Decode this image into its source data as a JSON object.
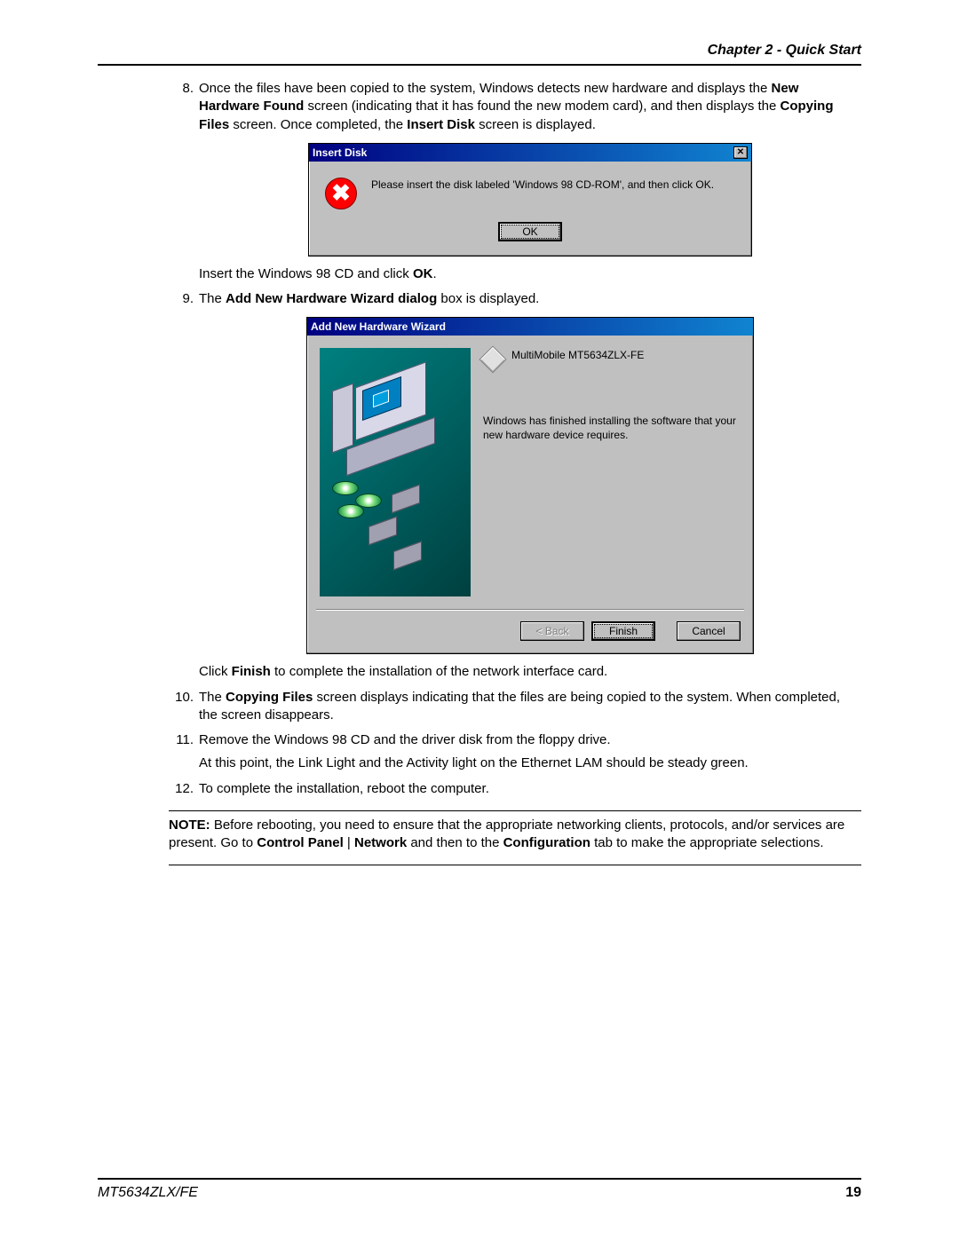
{
  "header": {
    "chapter": "Chapter 2 - Quick Start"
  },
  "step8": {
    "num": "8.",
    "text_a": "Once the files have been copied to the system, Windows detects new hardware and displays the ",
    "bold_a": "New Hardware Found",
    "text_b": " screen (indicating that it has found the new modem card), and then displays the ",
    "bold_b": "Copying Files",
    "text_c": " screen. Once completed, the ",
    "bold_c": "Insert Disk",
    "text_d": " screen is displayed.",
    "after_a": "Insert the Windows 98 CD and click ",
    "after_bold": "OK",
    "after_b": "."
  },
  "insert_dialog": {
    "title": "Insert Disk",
    "message": "Please insert the disk labeled 'Windows 98 CD-ROM', and then click OK.",
    "ok": "OK",
    "close_glyph": "✕"
  },
  "step9": {
    "num": "9.",
    "text_a": "The ",
    "bold_a": "Add New Hardware Wizard dialog",
    "text_b": " box is displayed.",
    "after_a": "Click ",
    "after_bold": "Finish",
    "after_b": " to complete the installation of the network interface card."
  },
  "wizard_dialog": {
    "title": "Add New Hardware Wizard",
    "device": "MultiMobile MT5634ZLX-FE",
    "message": "Windows has finished installing the software that your new hardware device requires.",
    "back": "< Back",
    "finish": "Finish",
    "cancel": "Cancel"
  },
  "step10": {
    "num": "10.",
    "text_a": "The ",
    "bold_a": "Copying Files",
    "text_b": " screen displays indicating that the files are being copied to the system. When completed, the screen disappears."
  },
  "step11": {
    "num": "11.",
    "line1": "Remove the Windows 98 CD and the driver disk from the floppy drive.",
    "line2": "At this point, the Link Light and the Activity light on the Ethernet LAM should be steady green."
  },
  "step12": {
    "num": "12.",
    "text": "To complete the installation, reboot the computer."
  },
  "note": {
    "label": "NOTE:",
    "a": " Before rebooting, you need to ensure that the appropriate networking clients, protocols, and/or services are present. Go to ",
    "b1": "Control Panel",
    "sep": " | ",
    "b2": "Network",
    "c": "  and then to the ",
    "b3": "Configuration",
    "d": " tab to make the appropriate selections."
  },
  "footer": {
    "model": "MT5634ZLX/FE",
    "page": "19"
  }
}
